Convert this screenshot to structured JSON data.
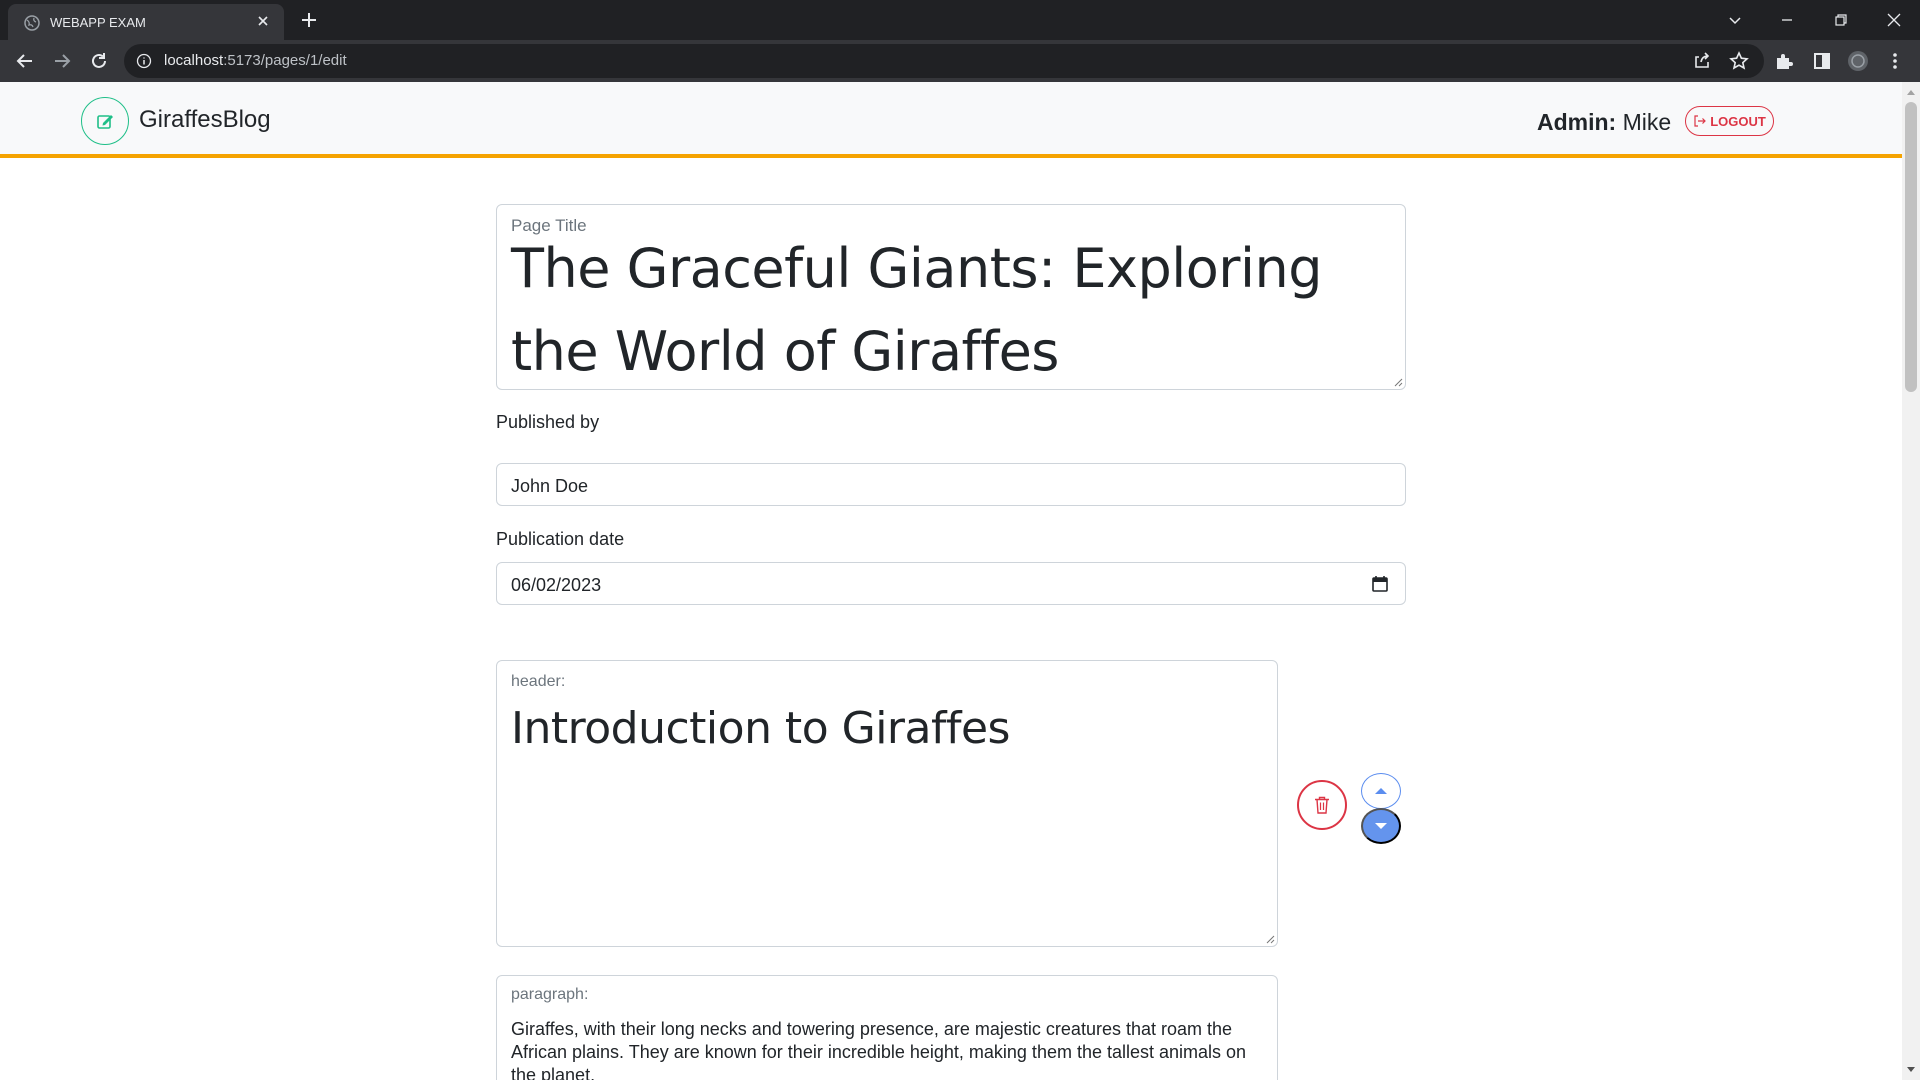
{
  "browser": {
    "tab_title": "WEBAPP EXAM",
    "url_host": "localhost",
    "url_path": ":5173/pages/1/edit"
  },
  "navbar": {
    "brand": "GiraffesBlog",
    "admin_label": "Admin:",
    "admin_name": "Mike",
    "logout_label": "LOGOUT",
    "accent_color": "#f5a300"
  },
  "form": {
    "title_label": "Page Title",
    "title_value": "The Graceful Giants: Exploring the World of Giraffes",
    "author_label": "Published by",
    "author_value": "John Doe",
    "date_label": "Publication date",
    "date_value": "06/02/2023"
  },
  "blocks": [
    {
      "type_label": "header:",
      "content": "Introduction to Giraffes"
    },
    {
      "type_label": "paragraph:",
      "content": "Giraffes, with their long necks and towering presence, are majestic creatures that roam the African plains. They are known for their incredible height, making them the tallest animals on the planet."
    }
  ]
}
